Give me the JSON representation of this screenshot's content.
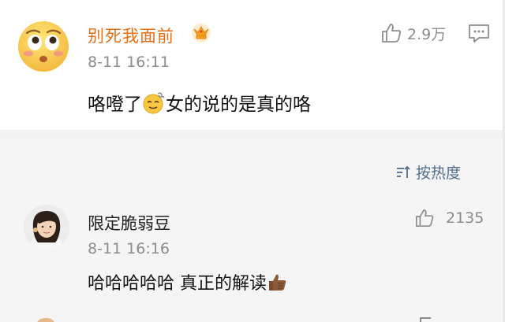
{
  "comment": {
    "avatar_icon": "surprised-face-emoji",
    "user": "别死我面前",
    "badge_icon": "crown-icon",
    "time": "8-11 16:11",
    "text_before": "咯噔了",
    "text_emoji_icon": "dizzy-face-emoji",
    "text_after": "女的说的是真的咯",
    "likes": "2.9万",
    "like_icon": "thumb-up-icon",
    "comment_icon": "comment-icon",
    "colors": {
      "username": "#e86e13",
      "text": "#111111",
      "meta": "#8c8c8c"
    }
  },
  "sort": {
    "label": "按热度",
    "icon": "sort-icon",
    "color": "#4f6d8c"
  },
  "reply": {
    "avatar_icon": "user-avatar",
    "user": "限定脆弱豆",
    "time": "8-11 16:16",
    "text": "哈哈哈哈哈 真正的解读",
    "text_emoji_icon": "thumbs-up-emoji",
    "likes": "2135",
    "like_icon": "thumb-up-icon"
  }
}
